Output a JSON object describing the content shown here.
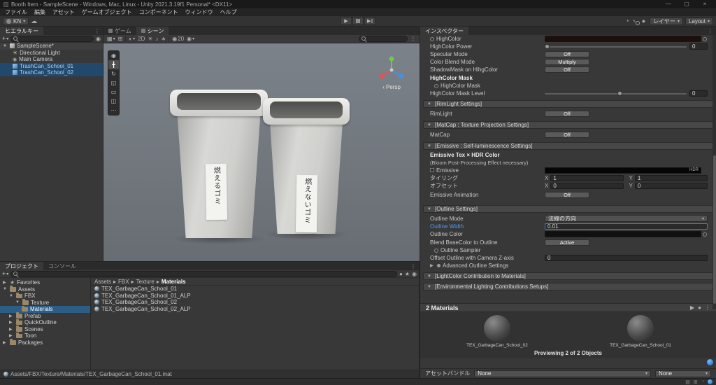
{
  "window": {
    "title": "Booth Item - SampleScene - Windows, Mac, Linux - Unity 2021.3.19f1 Personal* <DX11>"
  },
  "icons": {
    "minimize": "—",
    "maximize": "▢",
    "close": "×",
    "caret_down": "▾",
    "foldout_open": "▼",
    "foldout_closed": "▶",
    "play": "▶",
    "menu_dots": "⋮",
    "plus": "+",
    "breadcrumb_sep": "▸",
    "star": "★",
    "sun": "☀",
    "camera": "◉",
    "grid": "▦",
    "snap": "⊞",
    "shaded": "◐",
    "audio": "♪",
    "effects": "∗",
    "eye": "◉",
    "cloud": "☁",
    "persp_arrow": "‹",
    "tool_view": "◉",
    "tool_move": "╋",
    "tool_rotate": "↻",
    "tool_scale": "◱",
    "tool_rect": "▭",
    "tool_transform": "◫",
    "tool_custom": "⋯",
    "sphere": "●",
    "page": "▤",
    "clock": "◔"
  },
  "menus": [
    "ファイル",
    "編集",
    "アセット",
    "ゲームオブジェクト",
    "コンポーネント",
    "ウィンドウ",
    "ヘルプ"
  ],
  "toolbar": {
    "account": "KN",
    "layers": "レイヤー",
    "layout": "Layout"
  },
  "hierarchy": {
    "tab": "ヒエラルキー",
    "root": "SampleScene*",
    "items": [
      {
        "label": "Directional Light"
      },
      {
        "label": "Main Camera"
      },
      {
        "label": "TrashCan_School_01"
      },
      {
        "label": "TrashCan_School_02"
      }
    ]
  },
  "scene": {
    "tab_game": "ゲーム",
    "tab_scene": "シーン",
    "toggle_2d": "2D",
    "hidden_count": "20",
    "persp": "Persp",
    "can_left_label": "燃えるゴミ",
    "can_right_label": "燃えないゴミ"
  },
  "inspector": {
    "tab": "インスペクター",
    "highcolor": "HighColor",
    "highcolor_power": "HighColor Power",
    "highcolor_power_value": "0",
    "specular_mode": "Specular Mode",
    "specular_mode_value": "Off",
    "color_blend_mode": "Color Blend Mode",
    "color_blend_mode_value": "Multiply",
    "shadowmask": "ShadowMask on HihgColor",
    "shadowmask_value": "Off",
    "highcolor_mask_header": "HighColor Mask",
    "highcolor_mask": "HighColor Mask",
    "highcolor_mask_level": "HighColor Mask Level",
    "highcolor_mask_level_value": "0",
    "rimlight_section": "[RimLight Settings]",
    "rimlight": "RimLight",
    "rimlight_value": "Off",
    "matcap_section": "[MatCap : Texture Projection Settings]",
    "matcap": "MatCap",
    "matcap_value": "Off",
    "emissive_section": "[Emissive : Self-luminescence Settings]",
    "emissive_header": "Emissive Tex × HDR Color",
    "emissive_note": "(Bloom Post-Processing Effect necessary)",
    "emissive": "Emissive",
    "hdr_tag": "HDR",
    "tiling": "タイリング",
    "offset": "オフセット",
    "axis_x": "X",
    "axis_y": "Y",
    "tiling_x": "1",
    "tiling_y": "1",
    "offset_x": "0",
    "offset_y": "0",
    "emissive_animation": "Emissive Animation",
    "emissive_animation_value": "Off",
    "outline_section": "[Outline Settings]",
    "outline_mode": "Outline Mode",
    "outline_mode_value": "法線の方向",
    "outline_width": "Outline Width",
    "outline_width_value": "0.01",
    "outline_color": "Outline Color",
    "blend_basecolor": "Blend BaseColor to Outline",
    "blend_basecolor_value": "Active",
    "outline_sampler": "Outline Sampler",
    "offset_outline_z": "Offset Outline with Camera Z-axis",
    "offset_outline_z_value": "0",
    "advanced_outline": "Advanced Outline Settings",
    "lightcolor_section": "[LightColor Contribution to Materials]",
    "env_section": "[Environmental Lighting Contributions Setups]",
    "materials_header": "2 Materials",
    "material_1": "TEX_GarbageCan_School_02",
    "material_2": "TEX_GarbageCan_School_01",
    "previewing": "Previewing 2 of 2 Objects",
    "assetbundle_label": "アセットバンドル",
    "assetbundle_value": "None",
    "assetbundle_variant": "None"
  },
  "project": {
    "tab_project": "プロジェクト",
    "tab_console": "コンソール",
    "favorites": "Favorites",
    "tree": {
      "assets": "Assets",
      "fbx": "FBX",
      "texture": "Texture",
      "materials": "Materials",
      "prefab": "Prefab",
      "quickoutline": "QuickOutline",
      "scenes": "Scenes",
      "toon": "Toon",
      "packages": "Packages"
    },
    "breadcrumb": [
      "Assets",
      "FBX",
      "Texture",
      "Materials"
    ],
    "files": [
      "TEX_GarbageCan_School_01",
      "TEX_GarbageCan_School_01_ALP",
      "TEX_GarbageCan_School_02",
      "TEX_GarbageCan_School_02_ALP"
    ],
    "status_path": "Assets/FBX/Texture/Materials/TEX_GarbageCan_School_01.mat"
  },
  "colors": {
    "selection": "#2c5d87",
    "prefab_text": "#7fb3e6",
    "focus_border": "#3f7fbf"
  }
}
